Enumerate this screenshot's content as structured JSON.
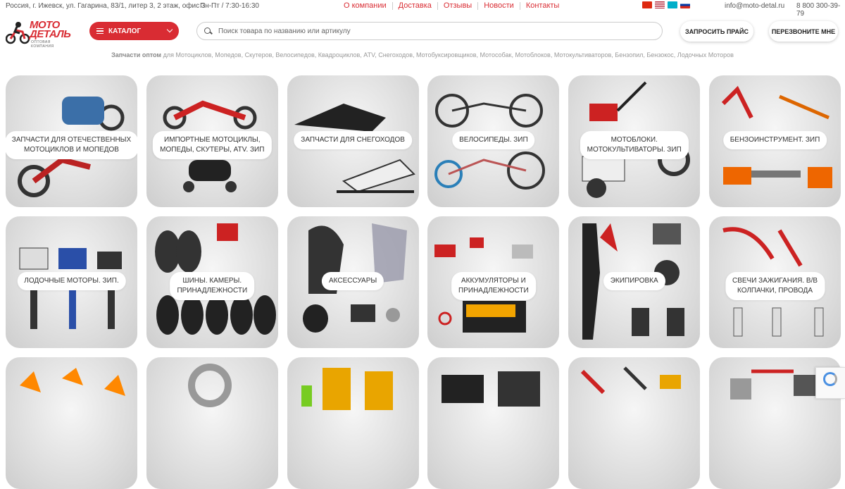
{
  "topbar": {
    "address": "Россия, г. Ижевск, ул. Гагарина, 83/1, литер 3, 2 этаж, офис 3",
    "hours": "Пн-Пт / 7:30-16:30",
    "nav": [
      "О компании",
      "Доставка",
      "Отзывы",
      "Новости",
      "Контакты"
    ],
    "flags": [
      {
        "name": "china-flag",
        "color": "#de2910"
      },
      {
        "name": "usa-flag",
        "color": "#3c3b6e"
      },
      {
        "name": "kazakhstan-flag",
        "color": "#00afca"
      },
      {
        "name": "russia-flag",
        "color": "#0039a6"
      }
    ],
    "email": "info@moto-detal.ru",
    "phone": "8 800 300-39-79"
  },
  "logo": {
    "line1": "МОТО",
    "line2": "ДЕТАЛЬ",
    "sub": "ОПТОВАЯ КОМПАНИЯ"
  },
  "header": {
    "catalog_label": "КАТАЛОГ",
    "search_placeholder": "Поиск товара по названию или артикулу",
    "price_button": "ЗАПРОСИТЬ ПРАЙС",
    "call_button": "ПЕРЕЗВОНИТЕ МНЕ"
  },
  "tagline": {
    "bold": "Запчасти оптом",
    "rest": " для Мотоциклов, Мопедов, Скутеров, Велосипедов, Квадроциклов, ATV, Снегоходов, Мотобуксировщиков, Мотособак, Мотоблоков, Мотокультиваторов, Бензопил, Бензокос, Лодочных Моторов"
  },
  "categories": [
    {
      "label": "ЗАПЧАСТИ ДЛЯ ОТЕЧЕСТВЕННЫХ\nМОТОЦИКЛОВ И МОПЕДОВ",
      "icon": "motorcycle-icon"
    },
    {
      "label": "ИМПОРТНЫЕ МОТОЦИКЛЫ,\nМОПЕДЫ, СКУТЕРЫ, ATV. ЗИП",
      "icon": "scooter-icon"
    },
    {
      "label": "ЗАПЧАСТИ ДЛЯ СНЕГОХОДОВ",
      "icon": "snowmobile-icon"
    },
    {
      "label": "ВЕЛОСИПЕДЫ. ЗИП",
      "icon": "bicycle-icon"
    },
    {
      "label": "МОТОБЛОКИ.\nМОТОКУЛЬТИВАТОРЫ. ЗИП",
      "icon": "tiller-icon"
    },
    {
      "label": "БЕНЗОИНСТРУМЕНТ. ЗИП",
      "icon": "chainsaw-icon"
    },
    {
      "label": "ЛОДОЧНЫЕ МОТОРЫ. ЗИП.",
      "icon": "outboard-motor-icon"
    },
    {
      "label": "ШИНЫ. КАМЕРЫ.\nПРИНАДЛЕЖНОСТИ",
      "icon": "tire-icon"
    },
    {
      "label": "АКСЕССУАРЫ",
      "icon": "mirror-icon"
    },
    {
      "label": "АККУМУЛЯТОРЫ И\nПРИНАДЛЕЖНОСТИ",
      "icon": "battery-icon"
    },
    {
      "label": "ЭКИПИРОВКА",
      "icon": "helmet-icon"
    },
    {
      "label": "СВЕЧИ ЗАЖИГАНИЯ. В/В\nКОЛПАЧКИ, ПРОВОДА",
      "icon": "spark-plug-icon"
    },
    {
      "label": "",
      "icon": "turn-signal-icon"
    },
    {
      "label": "",
      "icon": "bearing-icon"
    },
    {
      "label": "",
      "icon": "oil-canister-icon"
    },
    {
      "label": "",
      "icon": "engine-icon"
    },
    {
      "label": "",
      "icon": "tools-icon"
    },
    {
      "label": "",
      "icon": "carburetor-icon"
    }
  ]
}
